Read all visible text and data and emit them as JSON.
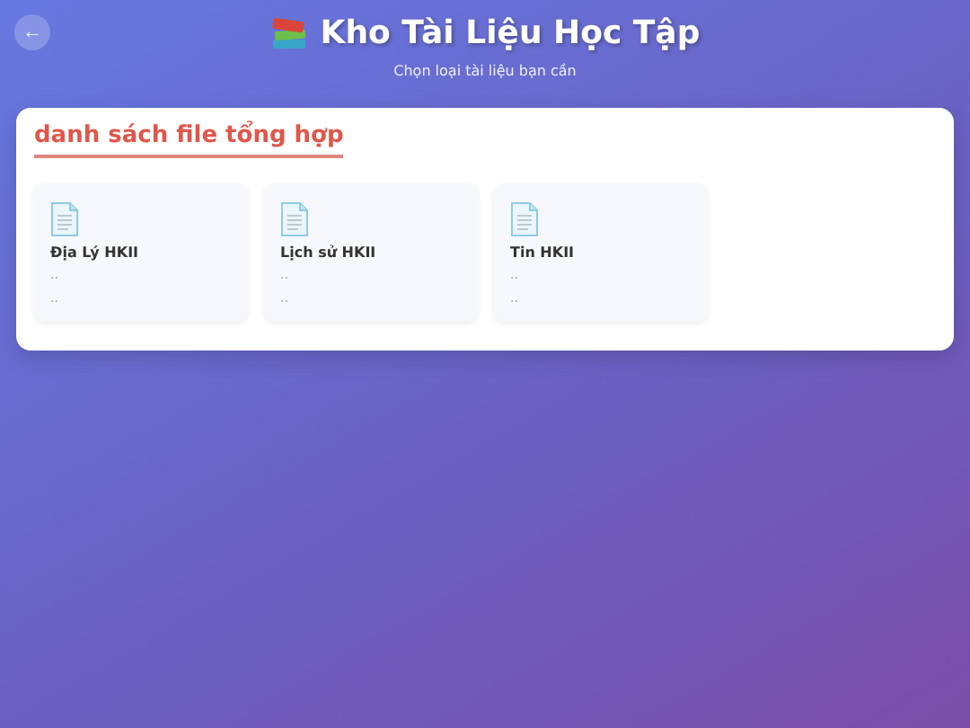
{
  "back_button": "←",
  "header": {
    "title": "Kho Tài Liệu Học Tập",
    "subtitle": "Chọn loại tài liệu bạn cần"
  },
  "section": {
    "title": "danh sách file tổng hợp",
    "files": [
      {
        "name": "Địa Lý HKII",
        "line_1": "..",
        "line_2": ".."
      },
      {
        "name": "Lịch sử HKII",
        "line_1": "..",
        "line_2": ".."
      },
      {
        "name": "Tin HKII",
        "line_1": "..",
        "line_2": ".."
      }
    ]
  }
}
